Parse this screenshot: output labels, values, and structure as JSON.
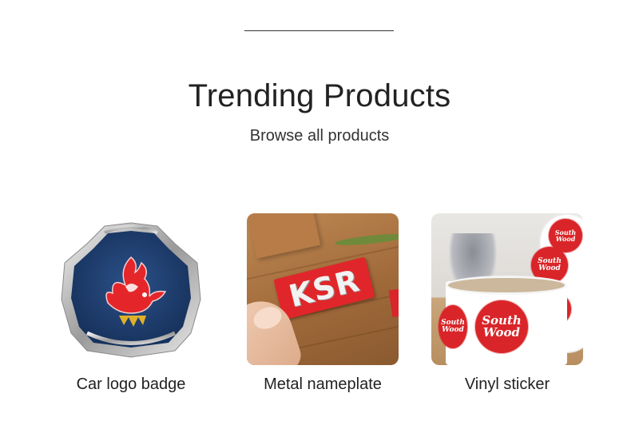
{
  "section": {
    "title": "Trending Products",
    "browse_link": "Browse all products"
  },
  "products": [
    {
      "label": "Car logo badge",
      "image_icon": "car-badge-image"
    },
    {
      "label": "Metal nameplate",
      "image_icon": "nameplate-image",
      "plate_text": "KSR"
    },
    {
      "label": "Vinyl sticker",
      "image_icon": "sticker-roll-image",
      "sticker_text_top": "South",
      "sticker_text_bottom": "Wood"
    }
  ],
  "colors": {
    "text": "#222222",
    "badge_blue": "#1f3f6e",
    "accent_red": "#d92529",
    "divider": "#333333"
  }
}
